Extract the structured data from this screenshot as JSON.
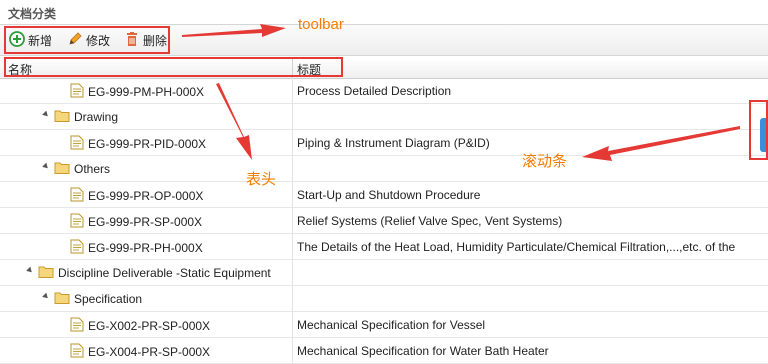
{
  "panel": {
    "title": "文档分类"
  },
  "toolbar": {
    "add_label": "新增",
    "edit_label": "修改",
    "delete_label": "删除"
  },
  "header": {
    "col_name": "名称",
    "col_title": "标题"
  },
  "rows": [
    {
      "kind": "file",
      "name": "EG-999-PM-PH-000X",
      "title": "Process Detailed Description"
    },
    {
      "kind": "folder",
      "name": "Drawing",
      "title": ""
    },
    {
      "kind": "file",
      "name": "EG-999-PR-PID-000X",
      "title": "Piping & Instrument Diagram (P&ID)"
    },
    {
      "kind": "folder",
      "name": "Others",
      "title": ""
    },
    {
      "kind": "file",
      "name": "EG-999-PR-OP-000X",
      "title": "Start-Up and Shutdown Procedure"
    },
    {
      "kind": "file",
      "name": "EG-999-PR-SP-000X",
      "title": "Relief Systems (Relief Valve Spec, Vent Systems)"
    },
    {
      "kind": "file",
      "name": "EG-999-PR-PH-000X",
      "title": "The Details of the Heat Load, Humidity Particulate/Chemical Filtration,...,etc. of the"
    },
    {
      "kind": "folder",
      "name": "Discipline Deliverable -Static Equipment",
      "title": ""
    },
    {
      "kind": "folder",
      "name": "Specification",
      "title": ""
    },
    {
      "kind": "file",
      "name": "EG-X002-PR-SP-000X",
      "title": "Mechanical Specification for Vessel"
    },
    {
      "kind": "file",
      "name": "EG-X004-PR-SP-000X",
      "title": "Mechanical Specification for Water Bath Heater"
    }
  ],
  "annotations": {
    "toolbar_label": "toolbar",
    "header_label": "表头",
    "scrollbar_label": "滚动条"
  },
  "colors": {
    "annotation_red": "#e53935",
    "annotation_text": "#f57c00",
    "scrollbar": "#3b8fd8"
  }
}
